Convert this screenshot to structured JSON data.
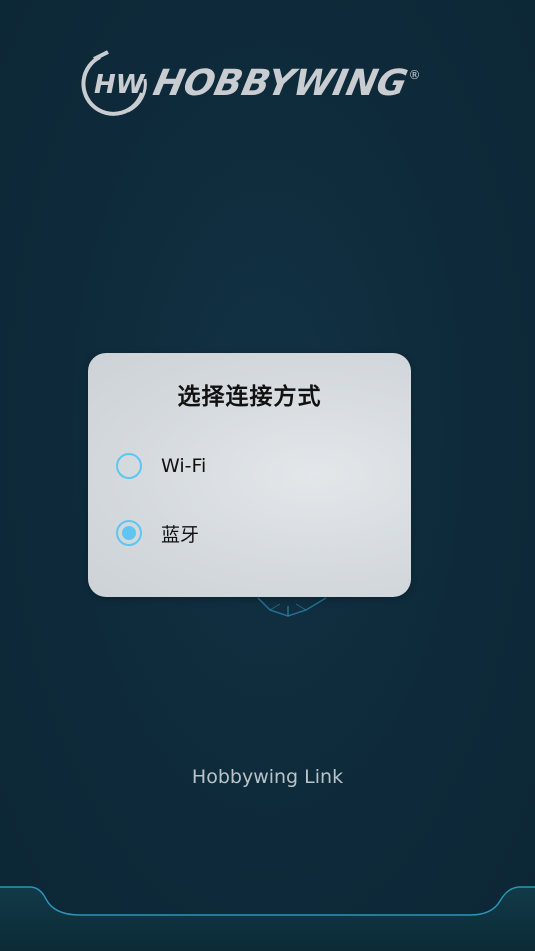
{
  "brand": {
    "wordmark": "HOBBYWING",
    "registered": "®",
    "monogram": "HW"
  },
  "dialog": {
    "title": "选择连接方式",
    "options": [
      {
        "label": "Wi-Fi",
        "selected": false
      },
      {
        "label": "蓝牙",
        "selected": true
      }
    ]
  },
  "footer": {
    "app_name": "Hobbywing Link"
  },
  "colors": {
    "background": "#0e2a3a",
    "accent": "#5fc5f2",
    "dialog_bg": "#d4d9dd",
    "logo": "#c9ccd0"
  }
}
